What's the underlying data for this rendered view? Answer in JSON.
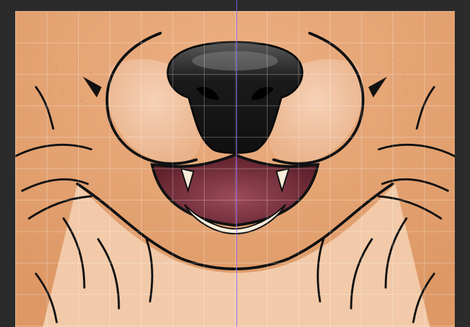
{
  "canvas": {
    "background_color": "#2b2b2b",
    "fur_color": "#e3a06d",
    "muzzle_color": "#f3c9ab",
    "nose_color": "#141414",
    "mouth_color": "#7a2f3c",
    "teeth_color": "#f7ecd9",
    "guide_color": "#8b5cf6",
    "grid_visible": true
  }
}
